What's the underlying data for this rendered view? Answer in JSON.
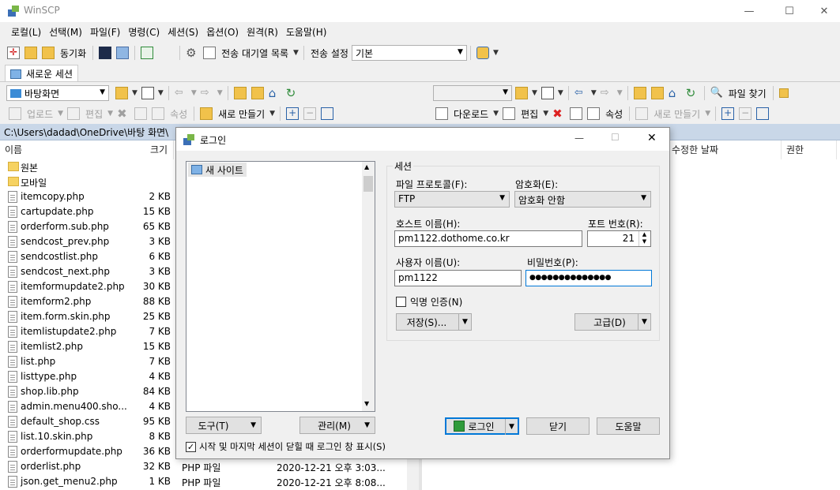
{
  "window": {
    "title": "WinSCP"
  },
  "menu": [
    "로컬(L)",
    "선택(M)",
    "파일(F)",
    "명령(C)",
    "세션(S)",
    "옵션(O)",
    "원격(R)",
    "도움말(H)"
  ],
  "toolbar1": {
    "sync_label": "동기화",
    "queue_label": "전송 대기열 목록",
    "transfer_settings_label": "전송 설정",
    "transfer_settings_value": "기본"
  },
  "session_tab": {
    "label": "새로운 세션"
  },
  "left_nav": {
    "location": "바탕화면"
  },
  "left_actions": {
    "upload": "업로드",
    "edit": "편집",
    "props": "속성",
    "new": "새로 만들기"
  },
  "right_nav": {
    "find": "파일 찾기"
  },
  "right_actions": {
    "download": "다운로드",
    "edit": "편집",
    "props": "속성",
    "new": "새로 만들기"
  },
  "path": "C:\\Users\\dadad\\OneDrive\\바탕 화면\\",
  "left_columns": {
    "name": "이름",
    "size": "크기"
  },
  "right_columns": {
    "modified": "수정한 날짜",
    "rights": "권한"
  },
  "files": [
    {
      "name": "원본",
      "size": "",
      "type": "",
      "date": "",
      "folder": true
    },
    {
      "name": "모바일",
      "size": "",
      "type": "",
      "date": "",
      "folder": true
    },
    {
      "name": "itemcopy.php",
      "size": "2 KB",
      "type": "",
      "date": ""
    },
    {
      "name": "cartupdate.php",
      "size": "15 KB",
      "type": "",
      "date": ""
    },
    {
      "name": "orderform.sub.php",
      "size": "65 KB",
      "type": "",
      "date": ""
    },
    {
      "name": "sendcost_prev.php",
      "size": "3 KB",
      "type": "",
      "date": ""
    },
    {
      "name": "sendcostlist.php",
      "size": "6 KB",
      "type": "",
      "date": ""
    },
    {
      "name": "sendcost_next.php",
      "size": "3 KB",
      "type": "",
      "date": ""
    },
    {
      "name": "itemformupdate2.php",
      "size": "30 KB",
      "type": "",
      "date": ""
    },
    {
      "name": "itemform2.php",
      "size": "88 KB",
      "type": "",
      "date": ""
    },
    {
      "name": "item.form.skin.php",
      "size": "25 KB",
      "type": "",
      "date": ""
    },
    {
      "name": "itemlistupdate2.php",
      "size": "7 KB",
      "type": "",
      "date": ""
    },
    {
      "name": "itemlist2.php",
      "size": "15 KB",
      "type": "",
      "date": ""
    },
    {
      "name": "list.php",
      "size": "7 KB",
      "type": "",
      "date": ""
    },
    {
      "name": "listtype.php",
      "size": "4 KB",
      "type": "",
      "date": ""
    },
    {
      "name": "shop.lib.php",
      "size": "84 KB",
      "type": "",
      "date": ""
    },
    {
      "name": "admin.menu400.sho...",
      "size": "4 KB",
      "type": "",
      "date": ""
    },
    {
      "name": "default_shop.css",
      "size": "95 KB",
      "type": "",
      "date": ""
    },
    {
      "name": "list.10.skin.php",
      "size": "8 KB",
      "type": "",
      "date": ""
    },
    {
      "name": "orderformupdate.php",
      "size": "36 KB",
      "type": "",
      "date": ""
    },
    {
      "name": "orderlist.php",
      "size": "32 KB",
      "type": "PHP 파일",
      "date": "2020-12-21   오후 3:03..."
    },
    {
      "name": "json.get_menu2.php",
      "size": "1 KB",
      "type": "PHP 파일",
      "date": "2020-12-21   오후 8:08..."
    }
  ],
  "dialog": {
    "title": "로그인",
    "site": "새 사이트",
    "tools_btn": "도구(T)",
    "manage_btn": "관리(M)",
    "show_on_start": "시작 및 마지막 세션이 닫힐 때 로그인 창 표시(S)",
    "session_group": "세션",
    "protocol_label": "파일 프로토콜(F):",
    "protocol_value": "FTP",
    "encryption_label": "암호화(E):",
    "encryption_value": "암호화 안함",
    "host_label": "호스트 이름(H):",
    "host_value": "pm1122.dothome.co.kr",
    "port_label": "포트 번호(R):",
    "port_value": "21",
    "user_label": "사용자 이름(U):",
    "user_value": "pm1122",
    "password_label": "비밀번호(P):",
    "password_value": "●●●●●●●●●●●●●●",
    "anonymous_label": "익명 인증(N)",
    "save_btn": "저장(S)...",
    "advanced_btn": "고급(D)",
    "login_btn": "로그인",
    "close_btn": "닫기",
    "help_btn": "도움말"
  }
}
